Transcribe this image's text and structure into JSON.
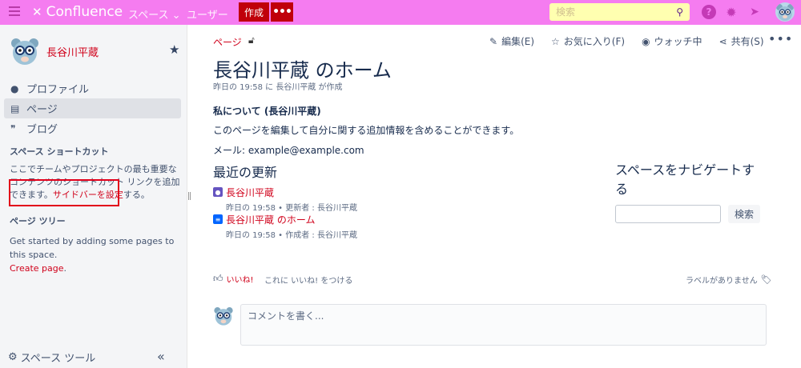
{
  "app": {
    "name": "Confluence"
  },
  "topbar": {
    "space_menu": "スペース",
    "users_menu": "ユーザー",
    "create_label": "作成",
    "more_label": "•••",
    "search_placeholder": "検索"
  },
  "sidebar": {
    "space_name": "長谷川平蔵",
    "nav": [
      {
        "label": "プロファイル",
        "icon": "person-icon"
      },
      {
        "label": "ページ",
        "icon": "page-icon"
      },
      {
        "label": "ブログ",
        "icon": "quote-icon"
      }
    ],
    "shortcuts_heading": "スペース ショートカット",
    "shortcuts_text": "ここでチームやプロジェクトの最も重要なコンテンツのショートカット リンクを追加できます。",
    "shortcuts_link": "サイドバーを設定",
    "shortcuts_suffix": "する。",
    "tree_heading": "ページ ツリー",
    "tree_text": "Get started by adding some pages to this space.",
    "tree_link": "Create page",
    "tree_suffix": ".",
    "tools_label": "スペース ツール",
    "collapse_label": "«"
  },
  "page": {
    "breadcrumb": "ページ",
    "actions": {
      "edit": "編集(E)",
      "favorite": "お気に入り(F)",
      "watch": "ウォッチ中",
      "share": "共有(S)",
      "more": "•••"
    },
    "title": "長谷川平蔵 のホーム",
    "meta": "昨日の 19:58 に 長谷川平蔵 が作成",
    "about_heading": "私について (長谷川平蔵)",
    "about_text": "このページを編集して自分に関する追加情報を含めることができます。",
    "email": "メール: example@example.com",
    "recent_heading": "最近の更新",
    "updates": [
      {
        "title": "長谷川平蔵",
        "detail": "昨日の 19:58 • 更新者 : 長谷川平蔵",
        "icon": "user-icon"
      },
      {
        "title": "長谷川平蔵 のホーム",
        "detail": "昨日の 19:58 • 作成者 : 長谷川平蔵",
        "icon": "page-icon"
      }
    ],
    "navigate_heading": "スペースをナビゲートする",
    "navigate_button": "検索",
    "like_label": "いいね!",
    "like_prompt": "これに いいね! をつける",
    "labels_text": "ラベルがありません",
    "comment_placeholder": "コメントを書く..."
  },
  "colors": {
    "topbar": "#f57cf0",
    "accent_red": "#d0021b",
    "create_button": "#c0000a",
    "search_bg": "#ffffb0"
  }
}
